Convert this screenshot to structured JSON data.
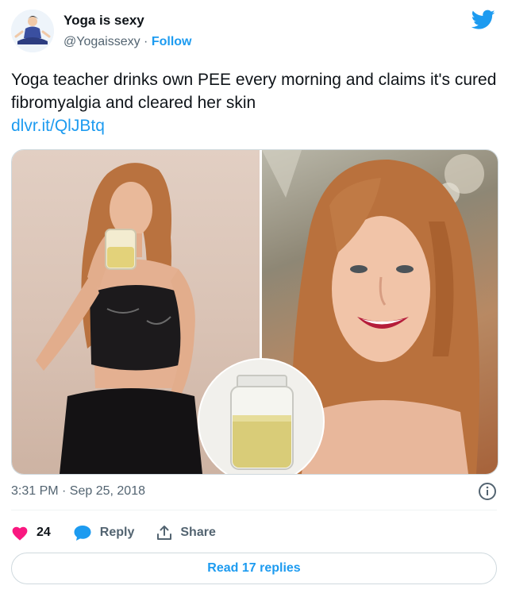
{
  "author": {
    "name": "Yoga is sexy",
    "handle": "@Yogaissexy",
    "separator": "·",
    "follow_label": "Follow"
  },
  "tweet": {
    "text": "Yoga teacher drinks own PEE every morning and claims it's cured fibromyalgia and cleared her skin",
    "link": "dlvr.it/QlJBtq"
  },
  "media": {
    "images": [
      "woman-drinking-from-jar",
      "smiling-woman-portrait",
      "jar-of-yellow-liquid-inset"
    ]
  },
  "meta": {
    "timestamp": "3:31 PM · Sep 25, 2018"
  },
  "actions": {
    "like_count": "24",
    "reply_label": "Reply",
    "share_label": "Share"
  },
  "read_replies_label": "Read 17 replies",
  "colors": {
    "accent": "#1d9bf0",
    "like": "#f91880",
    "muted": "#536471",
    "text": "#0f1419"
  }
}
